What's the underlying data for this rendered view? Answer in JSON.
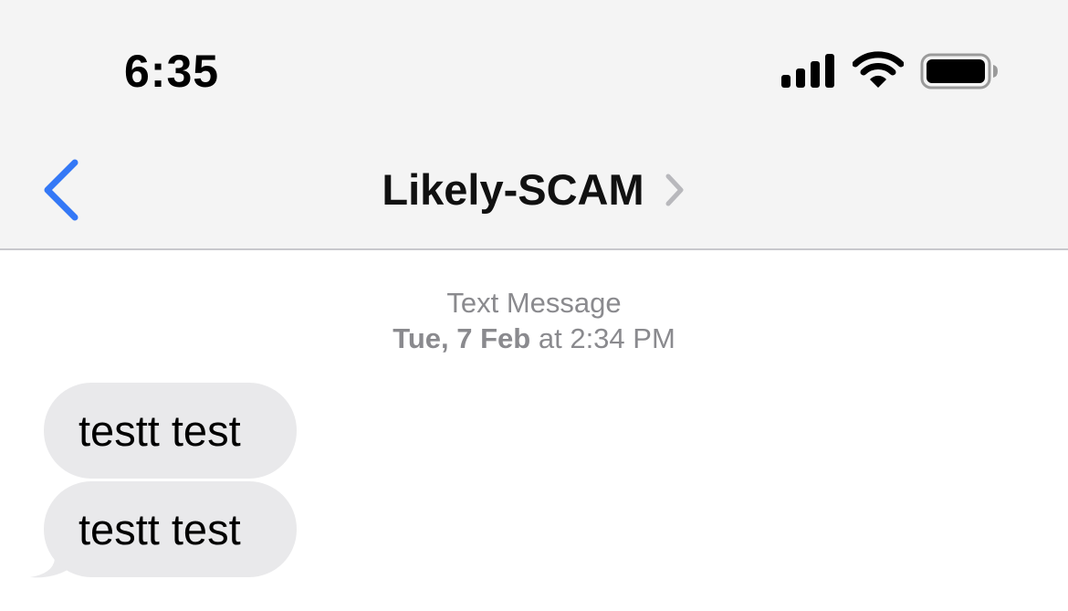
{
  "status_bar": {
    "time": "6:35",
    "icons": [
      "cellular-signal-icon",
      "wifi-icon",
      "battery-icon"
    ]
  },
  "nav": {
    "back_icon": "chevron-left-icon",
    "contact_name": "Likely-SCAM",
    "detail_icon": "chevron-right-icon"
  },
  "thread": {
    "service_label": "Text Message",
    "date_label": "Tue, 7 Feb",
    "time_label": "at 2:34 PM",
    "messages": [
      {
        "text": "testt test",
        "direction": "incoming"
      },
      {
        "text": "testt test",
        "direction": "incoming"
      }
    ]
  },
  "colors": {
    "accent": "#3478f6",
    "header_bg": "#f4f4f4",
    "bubble_incoming": "#e9e9eb",
    "meta_text": "#8a8a8e"
  }
}
